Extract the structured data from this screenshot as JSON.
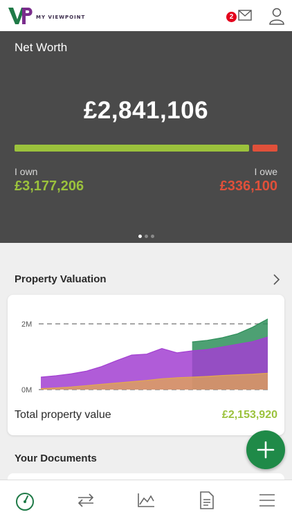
{
  "header": {
    "logo_text": "MY VIEWPOINT",
    "mail_count": "2",
    "icons": [
      "mail-icon",
      "profile-icon"
    ]
  },
  "net_worth": {
    "title": "Net Worth",
    "total": "£2,841,106",
    "own_label": "I own",
    "own_value": "£3,177,206",
    "owe_label": "I owe",
    "owe_value": "£336,100",
    "own_share": 0.904,
    "carousel_pages": 3,
    "carousel_active": 0
  },
  "property": {
    "section_title": "Property Valuation",
    "total_label": "Total property value",
    "total_value": "£2,153,920",
    "chart_data": {
      "type": "area",
      "y_ticks": [
        "2M",
        "0M"
      ],
      "ylim": [
        0,
        2000000
      ],
      "grid": "dashed lines at 0M and 2M",
      "series": [
        {
          "color": "#e3a84f",
          "values": [
            30000,
            50000,
            80000,
            120000,
            160000,
            200000,
            240000,
            280000,
            330000,
            360000,
            380000,
            400000,
            430000,
            450000,
            470000,
            500000
          ]
        },
        {
          "color": "#a23fd1",
          "values": [
            380000,
            420000,
            480000,
            560000,
            700000,
            880000,
            1050000,
            1080000,
            1250000,
            1120000,
            1180000,
            1220000,
            1300000,
            1380000,
            1460000,
            1600000
          ]
        },
        {
          "color": "#2e8f5a",
          "values": [
            null,
            null,
            null,
            null,
            null,
            null,
            null,
            null,
            null,
            null,
            1450000,
            1500000,
            1580000,
            1700000,
            1900000,
            2150000
          ]
        }
      ]
    }
  },
  "documents": {
    "section_title": "Your Documents"
  },
  "colors": {
    "accent_green": "#9bc23c",
    "accent_red": "#e0503a",
    "fab_green": "#1f8a48",
    "hero_bg": "#4a4a4a"
  },
  "nav": {
    "icons": [
      "dashboard-icon",
      "transfer-icon",
      "chart-icon",
      "document-icon",
      "menu-icon"
    ]
  }
}
